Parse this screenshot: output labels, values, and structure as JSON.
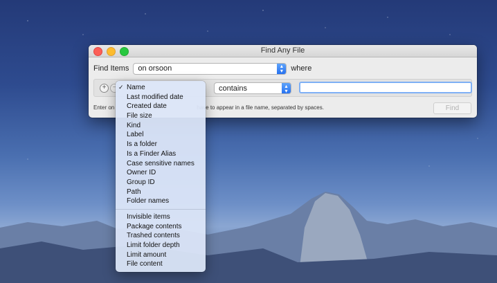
{
  "window": {
    "title": "Find Any File"
  },
  "find_row": {
    "label": "Find Items",
    "location_value": "on orsoon",
    "where_label": "where"
  },
  "criteria_row": {
    "add_glyph": "+",
    "remove_glyph": "−",
    "operator_value": "contains",
    "search_text": ""
  },
  "hint": {
    "visible_start": "Enter on",
    "visible_end": "have to appear in a file name, separated by spaces."
  },
  "find_button": "Find",
  "menu": {
    "selected": "Name",
    "group1": [
      "Name",
      "Last modified date",
      "Created date",
      "File size",
      "Kind",
      "Label",
      "Is a folder",
      "Is a Finder Alias",
      "Case sensitive names",
      "Owner ID",
      "Group ID",
      "Path",
      "Folder names"
    ],
    "group2": [
      "Invisible items",
      "Package contents",
      "Trashed contents",
      "Limit folder depth",
      "Limit amount",
      "File content"
    ]
  },
  "colors": {
    "accent": "#2671f0",
    "close": "#fc5f57",
    "minimize": "#fdbc2e",
    "zoom": "#28c840"
  }
}
